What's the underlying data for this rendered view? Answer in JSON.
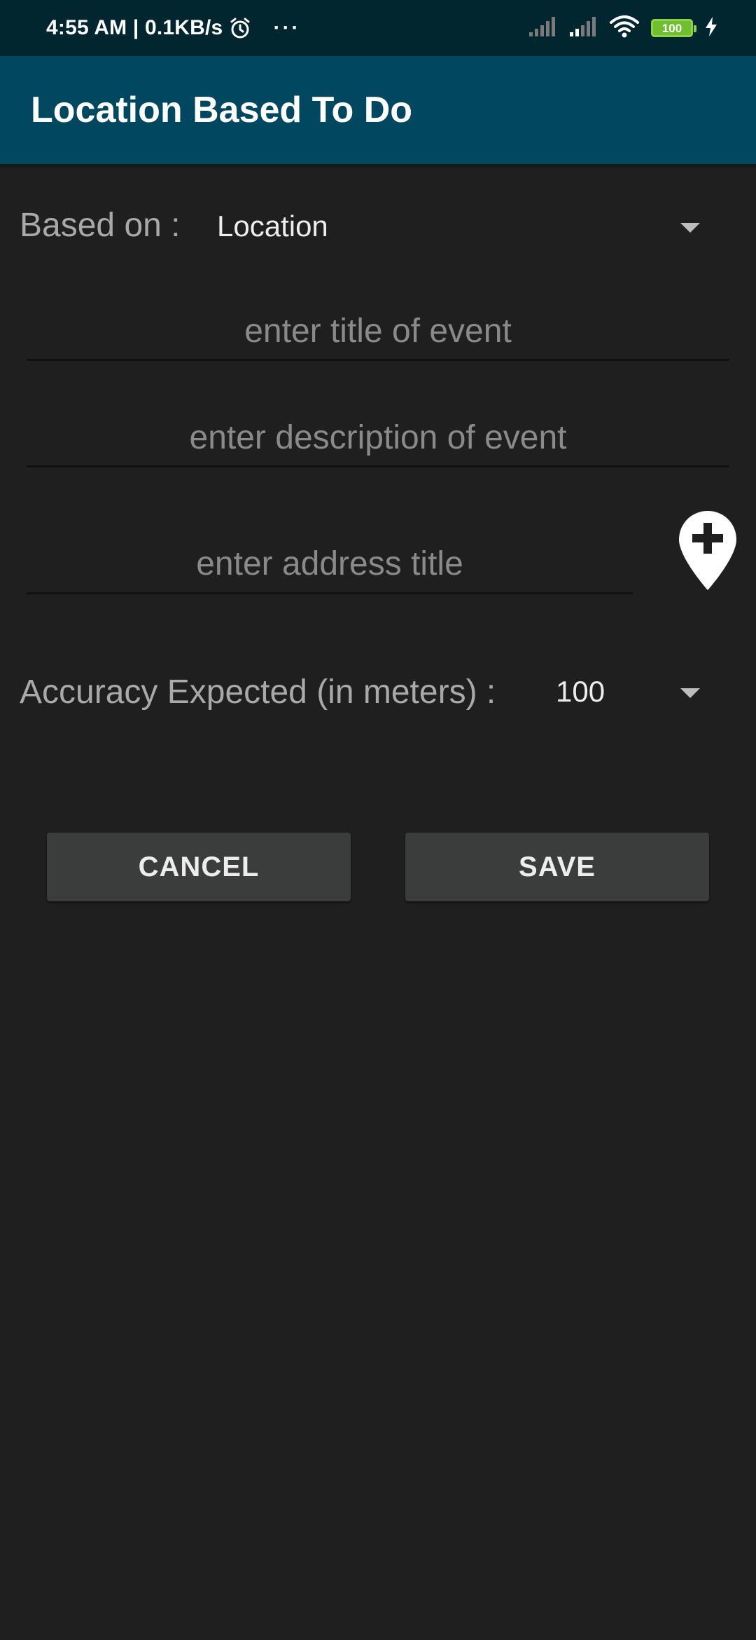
{
  "status_bar": {
    "time_speed": "4:55 AM | 0.1KB/s",
    "more": "···",
    "battery_level": "100",
    "icons": [
      "alarm-icon",
      "signal-icon",
      "signal-icon",
      "wifi-icon",
      "battery-icon",
      "charging-icon"
    ]
  },
  "app_bar": {
    "title": "Location Based To Do"
  },
  "form": {
    "based_on_label": "Based on :",
    "based_on_value": "Location",
    "title_placeholder": "enter title of event",
    "description_placeholder": "enter description of event",
    "address_placeholder": "enter address title",
    "accuracy_label": "Accuracy Expected (in meters) :",
    "accuracy_value": "100"
  },
  "buttons": {
    "cancel_label": "CANCEL",
    "save_label": "SAVE"
  },
  "colors": {
    "status_bar": "#01262f",
    "app_bar": "#01475f",
    "background": "#1f1f1f",
    "button": "#3b3c3c",
    "battery": "#6fbf2f"
  }
}
